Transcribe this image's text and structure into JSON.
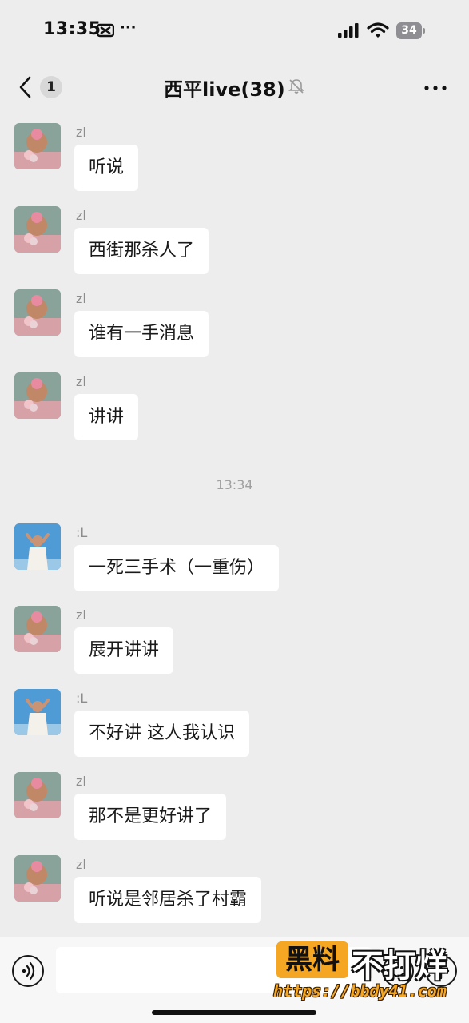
{
  "status_bar": {
    "time": "13:35",
    "dots": "···",
    "battery": "34"
  },
  "nav": {
    "back_badge": "1",
    "title": "西平live(38)"
  },
  "messages": [
    {
      "sender": "zl",
      "text": "听说",
      "avatar": "monkey-king-avatar"
    },
    {
      "sender": "zl",
      "text": "西街那杀人了",
      "avatar": "monkey-king-avatar"
    },
    {
      "sender": "zl",
      "text": "谁有一手消息",
      "avatar": "monkey-king-avatar"
    },
    {
      "sender": "zl",
      "text": "讲讲",
      "avatar": "monkey-king-avatar"
    },
    {
      "sender": ":L",
      "text": "一死三手术（一重伤）",
      "avatar": "man-sky-avatar"
    },
    {
      "sender": "zl",
      "text": "展开讲讲",
      "avatar": "monkey-king-avatar"
    },
    {
      "sender": ":L",
      "text": "不好讲 这人我认识",
      "avatar": "man-sky-avatar"
    },
    {
      "sender": "zl",
      "text": "那不是更好讲了",
      "avatar": "monkey-king-avatar"
    },
    {
      "sender": "zl",
      "text": "听说是邻居杀了村霸",
      "avatar": "monkey-king-avatar"
    }
  ],
  "timestamp": "13:34",
  "input": {
    "placeholder": ""
  },
  "watermark": {
    "badge": "黑料",
    "text": "不打烊",
    "url": "https://bbdy41.com"
  },
  "colors": {
    "background": "#ededed",
    "bubble": "#ffffff",
    "watermark_accent": "#f5a623"
  }
}
